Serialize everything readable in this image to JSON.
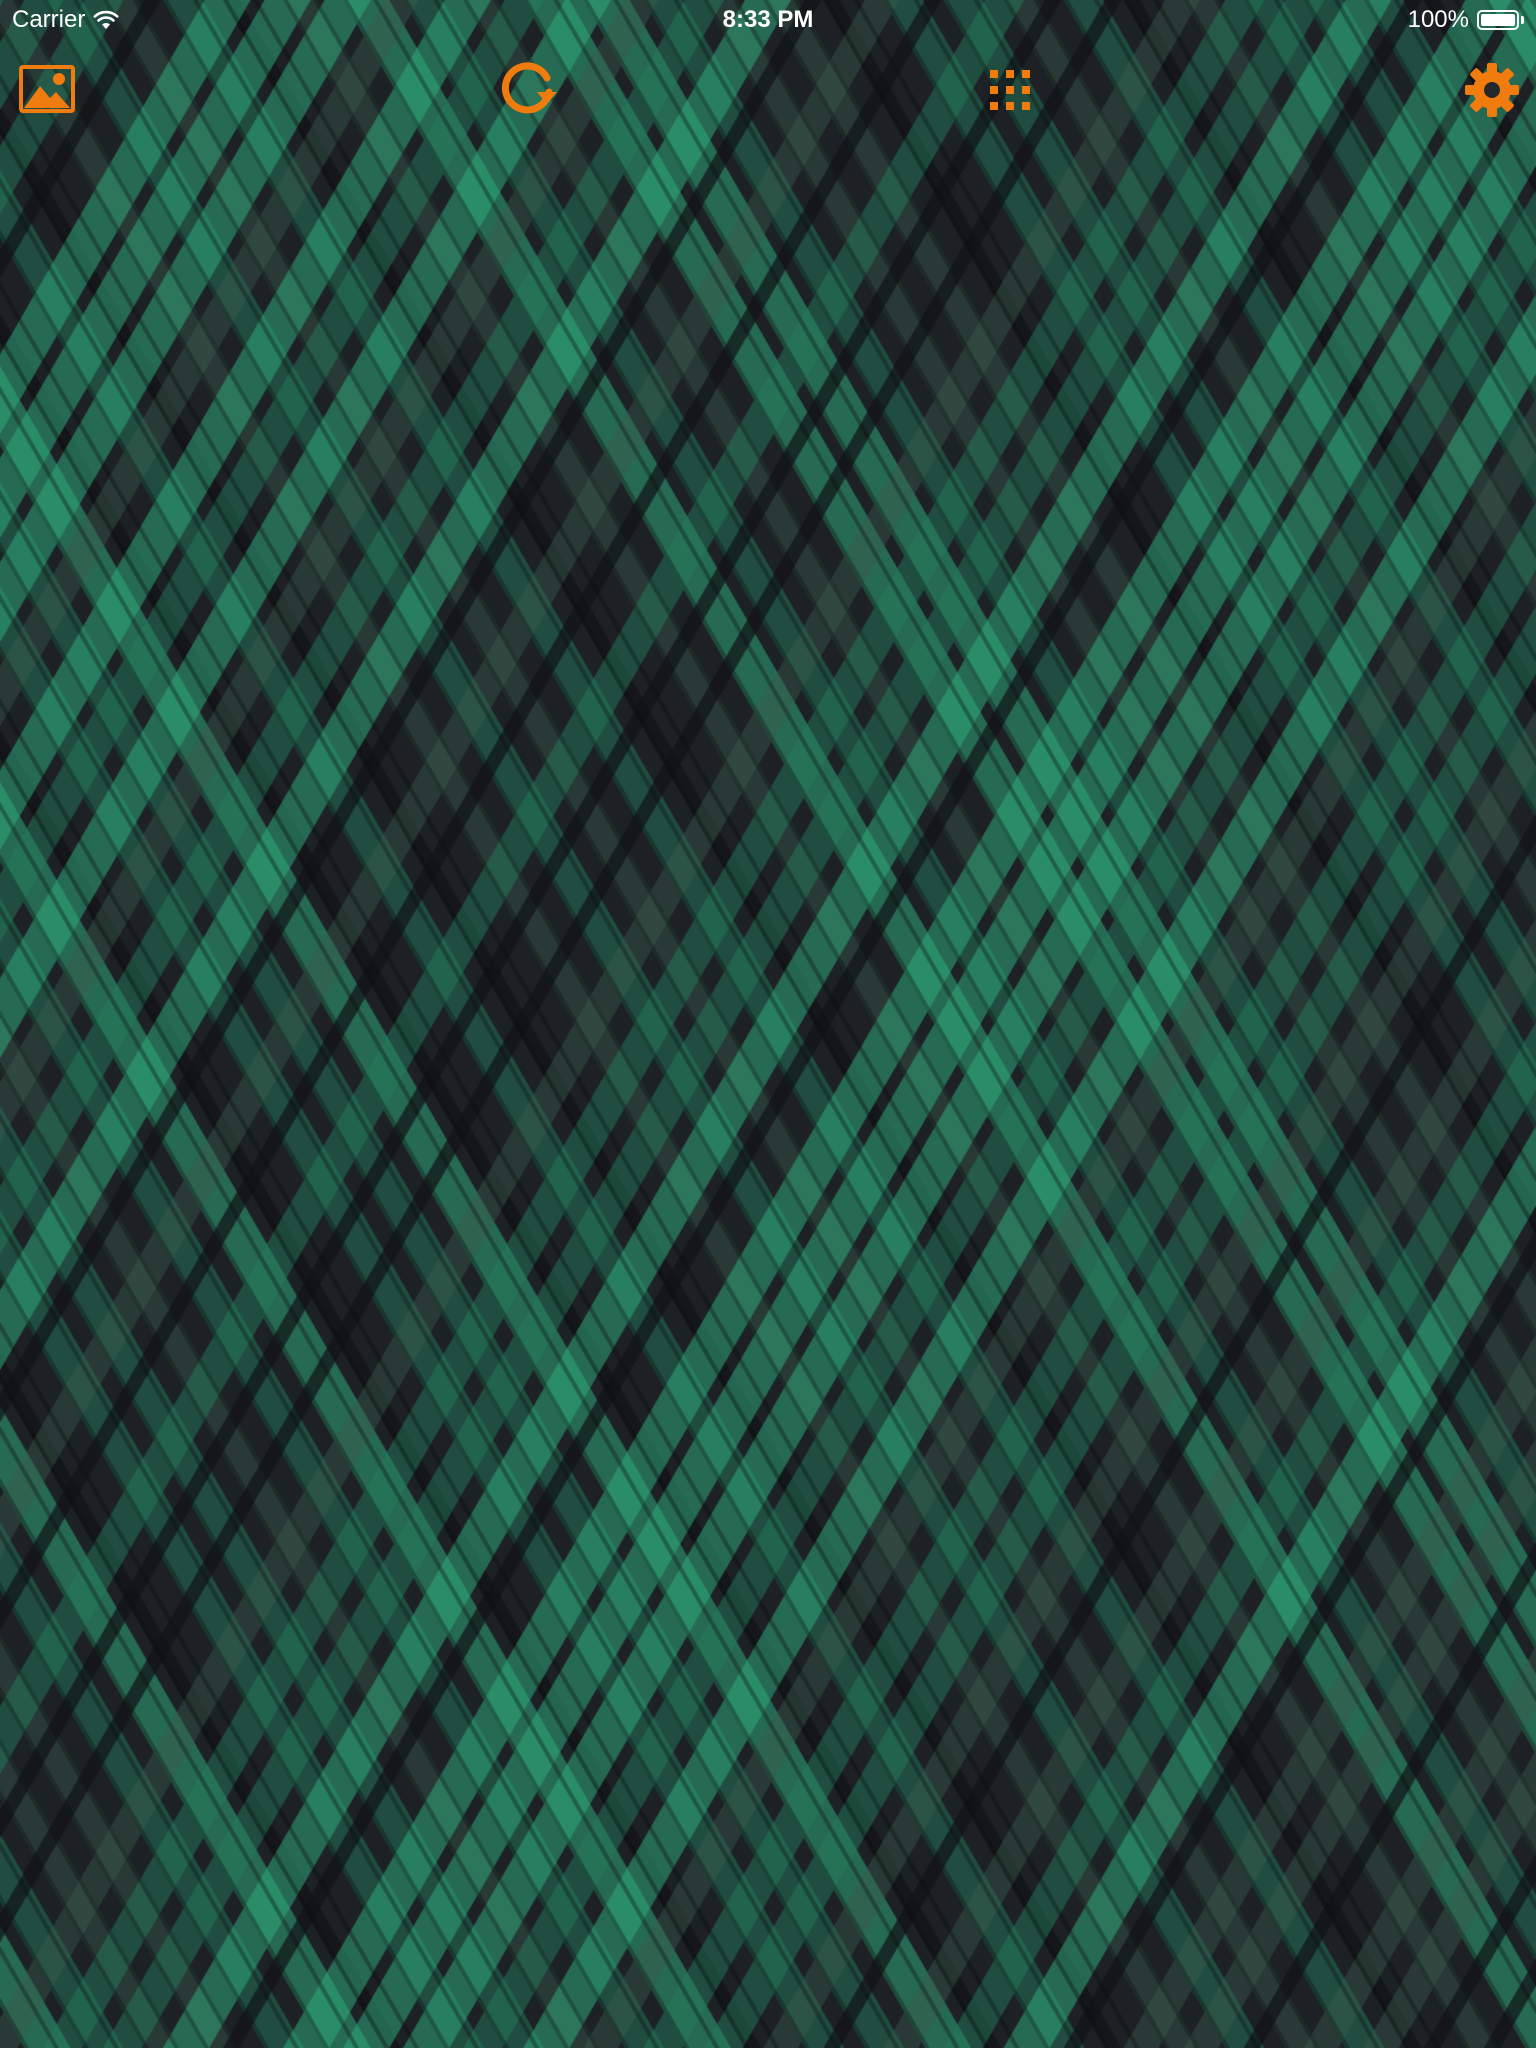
{
  "status_bar": {
    "carrier": "Carrier",
    "time": "8:33 PM",
    "battery": "100%",
    "battery_level": 1.0,
    "wifi_icon": "wifi-icon",
    "battery_icon": "battery-icon"
  },
  "toolbar": {
    "accent_color": "#f07c0f",
    "items": [
      {
        "icon": "gallery-image-icon"
      },
      {
        "icon": "refresh-icon"
      },
      {
        "icon": "grid-icon"
      },
      {
        "icon": "gear-icon"
      }
    ]
  },
  "wallpaper": {
    "pattern": "plaid",
    "base_color": "#1d2024",
    "stripe_colors": [
      "#2fa77a",
      "#247a5b",
      "#3a5c4e",
      "#111316"
    ]
  }
}
